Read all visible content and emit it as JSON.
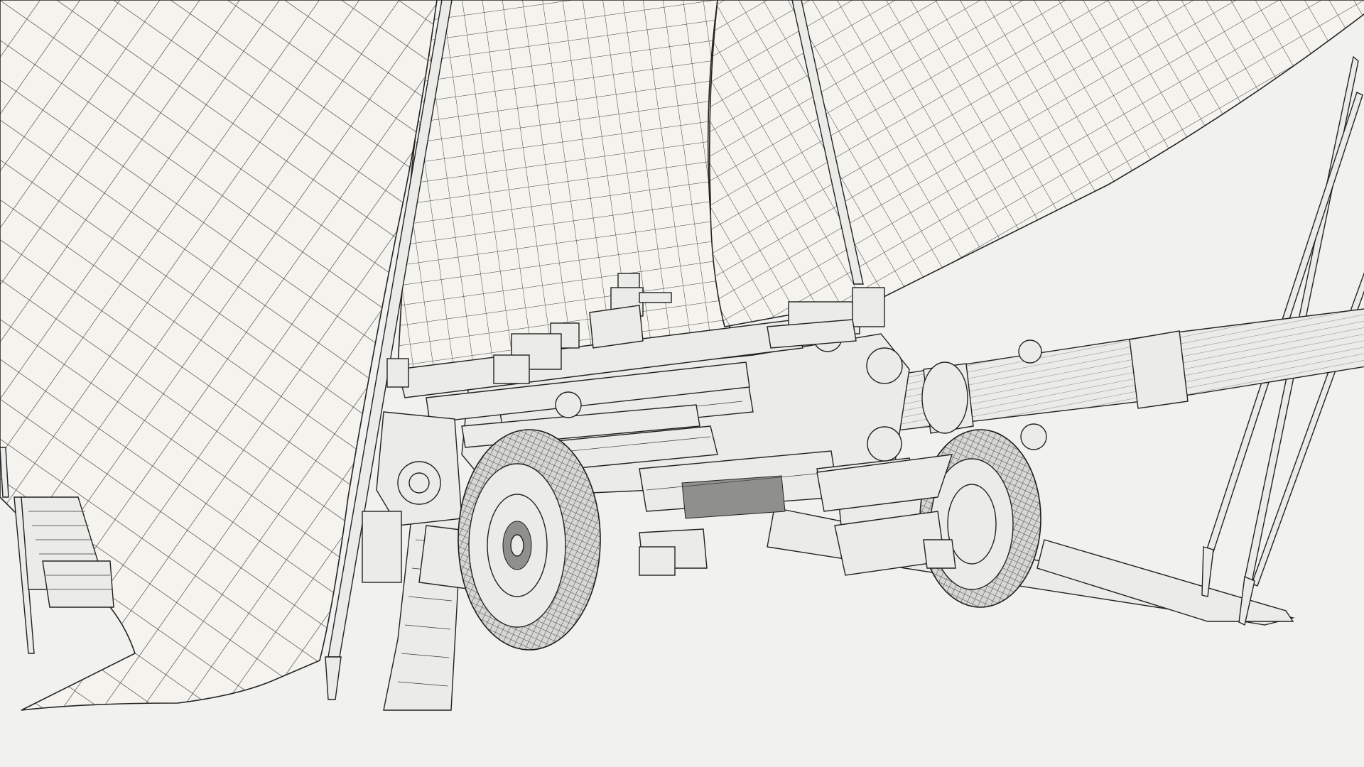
{
  "scene": {
    "subject": "wireframe-3d-render",
    "background_color": "#f1f1ef",
    "wire_color": "#2c2c2c",
    "surface_color": "#f4f3ee"
  }
}
